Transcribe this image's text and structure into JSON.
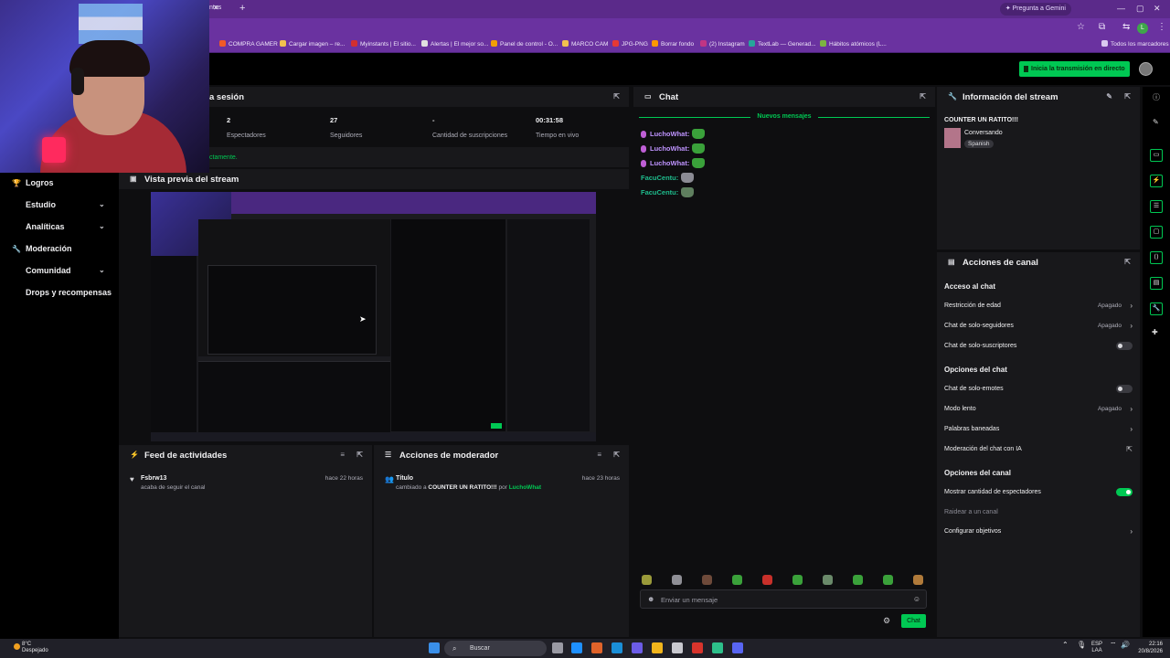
{
  "browser": {
    "tab_fragment": "ntos",
    "gemini_label": "Pregunta a Gemini",
    "bookmarks": [
      {
        "label": "COMPRA GAMER",
        "color": "#f05a28"
      },
      {
        "label": "Cargar imagen – re...",
        "color": "#f2c14e"
      },
      {
        "label": "Myinstants | El sitio...",
        "color": "#d32f2f"
      },
      {
        "label": "Alertas | El mejor so...",
        "color": "#e0e0e0"
      },
      {
        "label": "Panel de control - O...",
        "color": "#f29f05"
      },
      {
        "label": "MARCO CAM",
        "color": "#f2c14e"
      },
      {
        "label": "JPG-PNG",
        "color": "#e53935"
      },
      {
        "label": "Borrar fondo",
        "color": "#ff9800"
      },
      {
        "label": "(2) Instagram",
        "color": "#c13584"
      },
      {
        "label": "TextLab — Generad...",
        "color": "#26a69a"
      },
      {
        "label": "Hábitos atómicos (L...",
        "color": "#7cb342"
      }
    ],
    "all_bookmarks": "Todos los marcadores"
  },
  "topnav": {
    "golive_label": "Inicia la transmisión en directo"
  },
  "sidebar": {
    "items": [
      {
        "label": "Logros",
        "icon": "trophy-icon",
        "glyph": "🏆",
        "chevron": false
      },
      {
        "label": "Estudio",
        "icon": "studio-icon",
        "glyph": "",
        "chevron": true
      },
      {
        "label": "Analíticas",
        "icon": "analytics-icon",
        "glyph": "",
        "chevron": true
      },
      {
        "label": "Moderación",
        "icon": "wrench-icon",
        "glyph": "🔧",
        "chevron": false
      },
      {
        "label": "Comunidad",
        "icon": "community-icon",
        "glyph": "",
        "chevron": true
      },
      {
        "label": "Drops y recompensas",
        "icon": "gift-icon",
        "glyph": "",
        "chevron": false
      }
    ]
  },
  "session": {
    "title": "a sesión",
    "stats": [
      {
        "value": "2",
        "label": "Espectadores"
      },
      {
        "value": "27",
        "label": "Seguidores"
      },
      {
        "value": "-",
        "label": "Cantidad de suscripciones"
      },
      {
        "value": "00:31:58",
        "label": "Tiempo en vivo"
      }
    ],
    "note": "ctamente."
  },
  "preview": {
    "title": "Vista previa del stream"
  },
  "feed": {
    "title": "Feed de actividades",
    "events": [
      {
        "name": "Fsbrw13",
        "text": "acaba de seguir el canal",
        "time": "hace 22 horas"
      }
    ]
  },
  "mod_actions": {
    "title": "Acciones de moderador",
    "events": [
      {
        "name": "Título",
        "prefix": "cambiado a",
        "value": "COUNTER UN RATITO!!!",
        "by": "por",
        "user": "LuchoWhat",
        "time": "hace 23 horas"
      }
    ]
  },
  "chat": {
    "title": "Chat",
    "new_messages": "Nuevos mensajes",
    "messages": [
      {
        "user": "LuchoWhat:",
        "color": "#bf94ff",
        "badge": true,
        "emote": "green"
      },
      {
        "user": "LuchoWhat:",
        "color": "#bf94ff",
        "badge": true,
        "emote": "green"
      },
      {
        "user": "LuchoWhat:",
        "color": "#bf94ff",
        "badge": true,
        "emote": "green"
      },
      {
        "user": "FacuCentu:",
        "color": "#1ebc8c",
        "badge": false,
        "emote": "gray"
      },
      {
        "user": "FacuCentu:",
        "color": "#1ebc8c",
        "badge": false,
        "emote": "dino"
      }
    ],
    "input_placeholder": "Enviar un mensaje",
    "send_label": "Chat"
  },
  "stream_info": {
    "title": "Información del stream",
    "stream_title": "COUNTER UN RATITO!!!",
    "category": "Conversando",
    "language": "Spanish"
  },
  "channel_actions": {
    "title": "Acciones de canal",
    "sections": [
      {
        "heading": "Acceso al chat",
        "rows": [
          {
            "label": "Restricción de edad",
            "value": "Apagado",
            "kind": "arrow"
          },
          {
            "label": "Chat de solo-seguidores",
            "value": "Apagado",
            "kind": "arrow"
          },
          {
            "label": "Chat de solo-suscriptores",
            "value": "",
            "kind": "toggle-off"
          }
        ]
      },
      {
        "heading": "Opciones del chat",
        "rows": [
          {
            "label": "Chat de solo-emotes",
            "value": "",
            "kind": "toggle-off"
          },
          {
            "label": "Modo lento",
            "value": "Apagado",
            "kind": "arrow"
          },
          {
            "label": "Palabras baneadas",
            "value": "",
            "kind": "arrow"
          },
          {
            "label": "Moderación del chat con IA",
            "value": "",
            "kind": "external"
          }
        ]
      },
      {
        "heading": "Opciones del canal",
        "rows": [
          {
            "label": "Mostrar cantidad de espectadores",
            "value": "",
            "kind": "toggle-on"
          },
          {
            "label": "Raidear a un canal",
            "value": "",
            "kind": "dim"
          },
          {
            "label": "Configurar objetivos",
            "value": "",
            "kind": "arrow"
          }
        ]
      }
    ]
  },
  "taskbar": {
    "temperature": "8°C",
    "weather": "Despejado",
    "search_label": "Buscar",
    "lang_top": "ESP",
    "lang_bottom": "LAA",
    "time": "22:16",
    "date": "20/8/2026"
  },
  "colors": {
    "accent": "#00c853",
    "browser_purple": "#6a32a0",
    "panel": "#18181b",
    "background": "#0e0e10"
  }
}
